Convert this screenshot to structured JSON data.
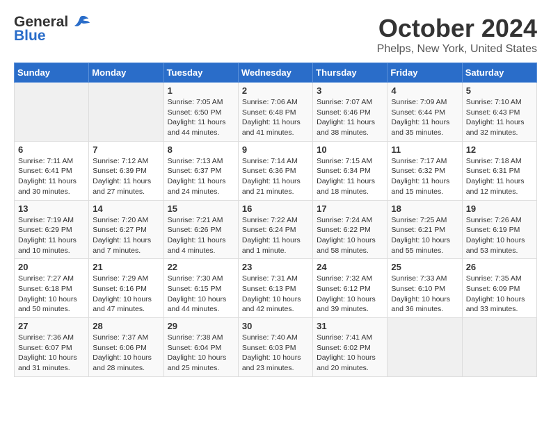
{
  "header": {
    "logo_general": "General",
    "logo_blue": "Blue",
    "month": "October 2024",
    "location": "Phelps, New York, United States"
  },
  "weekdays": [
    "Sunday",
    "Monday",
    "Tuesday",
    "Wednesday",
    "Thursday",
    "Friday",
    "Saturday"
  ],
  "weeks": [
    [
      {
        "day": "",
        "sunrise": "",
        "sunset": "",
        "daylight": ""
      },
      {
        "day": "",
        "sunrise": "",
        "sunset": "",
        "daylight": ""
      },
      {
        "day": "1",
        "sunrise": "Sunrise: 7:05 AM",
        "sunset": "Sunset: 6:50 PM",
        "daylight": "Daylight: 11 hours and 44 minutes."
      },
      {
        "day": "2",
        "sunrise": "Sunrise: 7:06 AM",
        "sunset": "Sunset: 6:48 PM",
        "daylight": "Daylight: 11 hours and 41 minutes."
      },
      {
        "day": "3",
        "sunrise": "Sunrise: 7:07 AM",
        "sunset": "Sunset: 6:46 PM",
        "daylight": "Daylight: 11 hours and 38 minutes."
      },
      {
        "day": "4",
        "sunrise": "Sunrise: 7:09 AM",
        "sunset": "Sunset: 6:44 PM",
        "daylight": "Daylight: 11 hours and 35 minutes."
      },
      {
        "day": "5",
        "sunrise": "Sunrise: 7:10 AM",
        "sunset": "Sunset: 6:43 PM",
        "daylight": "Daylight: 11 hours and 32 minutes."
      }
    ],
    [
      {
        "day": "6",
        "sunrise": "Sunrise: 7:11 AM",
        "sunset": "Sunset: 6:41 PM",
        "daylight": "Daylight: 11 hours and 30 minutes."
      },
      {
        "day": "7",
        "sunrise": "Sunrise: 7:12 AM",
        "sunset": "Sunset: 6:39 PM",
        "daylight": "Daylight: 11 hours and 27 minutes."
      },
      {
        "day": "8",
        "sunrise": "Sunrise: 7:13 AM",
        "sunset": "Sunset: 6:37 PM",
        "daylight": "Daylight: 11 hours and 24 minutes."
      },
      {
        "day": "9",
        "sunrise": "Sunrise: 7:14 AM",
        "sunset": "Sunset: 6:36 PM",
        "daylight": "Daylight: 11 hours and 21 minutes."
      },
      {
        "day": "10",
        "sunrise": "Sunrise: 7:15 AM",
        "sunset": "Sunset: 6:34 PM",
        "daylight": "Daylight: 11 hours and 18 minutes."
      },
      {
        "day": "11",
        "sunrise": "Sunrise: 7:17 AM",
        "sunset": "Sunset: 6:32 PM",
        "daylight": "Daylight: 11 hours and 15 minutes."
      },
      {
        "day": "12",
        "sunrise": "Sunrise: 7:18 AM",
        "sunset": "Sunset: 6:31 PM",
        "daylight": "Daylight: 11 hours and 12 minutes."
      }
    ],
    [
      {
        "day": "13",
        "sunrise": "Sunrise: 7:19 AM",
        "sunset": "Sunset: 6:29 PM",
        "daylight": "Daylight: 11 hours and 10 minutes."
      },
      {
        "day": "14",
        "sunrise": "Sunrise: 7:20 AM",
        "sunset": "Sunset: 6:27 PM",
        "daylight": "Daylight: 11 hours and 7 minutes."
      },
      {
        "day": "15",
        "sunrise": "Sunrise: 7:21 AM",
        "sunset": "Sunset: 6:26 PM",
        "daylight": "Daylight: 11 hours and 4 minutes."
      },
      {
        "day": "16",
        "sunrise": "Sunrise: 7:22 AM",
        "sunset": "Sunset: 6:24 PM",
        "daylight": "Daylight: 11 hours and 1 minute."
      },
      {
        "day": "17",
        "sunrise": "Sunrise: 7:24 AM",
        "sunset": "Sunset: 6:22 PM",
        "daylight": "Daylight: 10 hours and 58 minutes."
      },
      {
        "day": "18",
        "sunrise": "Sunrise: 7:25 AM",
        "sunset": "Sunset: 6:21 PM",
        "daylight": "Daylight: 10 hours and 55 minutes."
      },
      {
        "day": "19",
        "sunrise": "Sunrise: 7:26 AM",
        "sunset": "Sunset: 6:19 PM",
        "daylight": "Daylight: 10 hours and 53 minutes."
      }
    ],
    [
      {
        "day": "20",
        "sunrise": "Sunrise: 7:27 AM",
        "sunset": "Sunset: 6:18 PM",
        "daylight": "Daylight: 10 hours and 50 minutes."
      },
      {
        "day": "21",
        "sunrise": "Sunrise: 7:29 AM",
        "sunset": "Sunset: 6:16 PM",
        "daylight": "Daylight: 10 hours and 47 minutes."
      },
      {
        "day": "22",
        "sunrise": "Sunrise: 7:30 AM",
        "sunset": "Sunset: 6:15 PM",
        "daylight": "Daylight: 10 hours and 44 minutes."
      },
      {
        "day": "23",
        "sunrise": "Sunrise: 7:31 AM",
        "sunset": "Sunset: 6:13 PM",
        "daylight": "Daylight: 10 hours and 42 minutes."
      },
      {
        "day": "24",
        "sunrise": "Sunrise: 7:32 AM",
        "sunset": "Sunset: 6:12 PM",
        "daylight": "Daylight: 10 hours and 39 minutes."
      },
      {
        "day": "25",
        "sunrise": "Sunrise: 7:33 AM",
        "sunset": "Sunset: 6:10 PM",
        "daylight": "Daylight: 10 hours and 36 minutes."
      },
      {
        "day": "26",
        "sunrise": "Sunrise: 7:35 AM",
        "sunset": "Sunset: 6:09 PM",
        "daylight": "Daylight: 10 hours and 33 minutes."
      }
    ],
    [
      {
        "day": "27",
        "sunrise": "Sunrise: 7:36 AM",
        "sunset": "Sunset: 6:07 PM",
        "daylight": "Daylight: 10 hours and 31 minutes."
      },
      {
        "day": "28",
        "sunrise": "Sunrise: 7:37 AM",
        "sunset": "Sunset: 6:06 PM",
        "daylight": "Daylight: 10 hours and 28 minutes."
      },
      {
        "day": "29",
        "sunrise": "Sunrise: 7:38 AM",
        "sunset": "Sunset: 6:04 PM",
        "daylight": "Daylight: 10 hours and 25 minutes."
      },
      {
        "day": "30",
        "sunrise": "Sunrise: 7:40 AM",
        "sunset": "Sunset: 6:03 PM",
        "daylight": "Daylight: 10 hours and 23 minutes."
      },
      {
        "day": "31",
        "sunrise": "Sunrise: 7:41 AM",
        "sunset": "Sunset: 6:02 PM",
        "daylight": "Daylight: 10 hours and 20 minutes."
      },
      {
        "day": "",
        "sunrise": "",
        "sunset": "",
        "daylight": ""
      },
      {
        "day": "",
        "sunrise": "",
        "sunset": "",
        "daylight": ""
      }
    ]
  ]
}
